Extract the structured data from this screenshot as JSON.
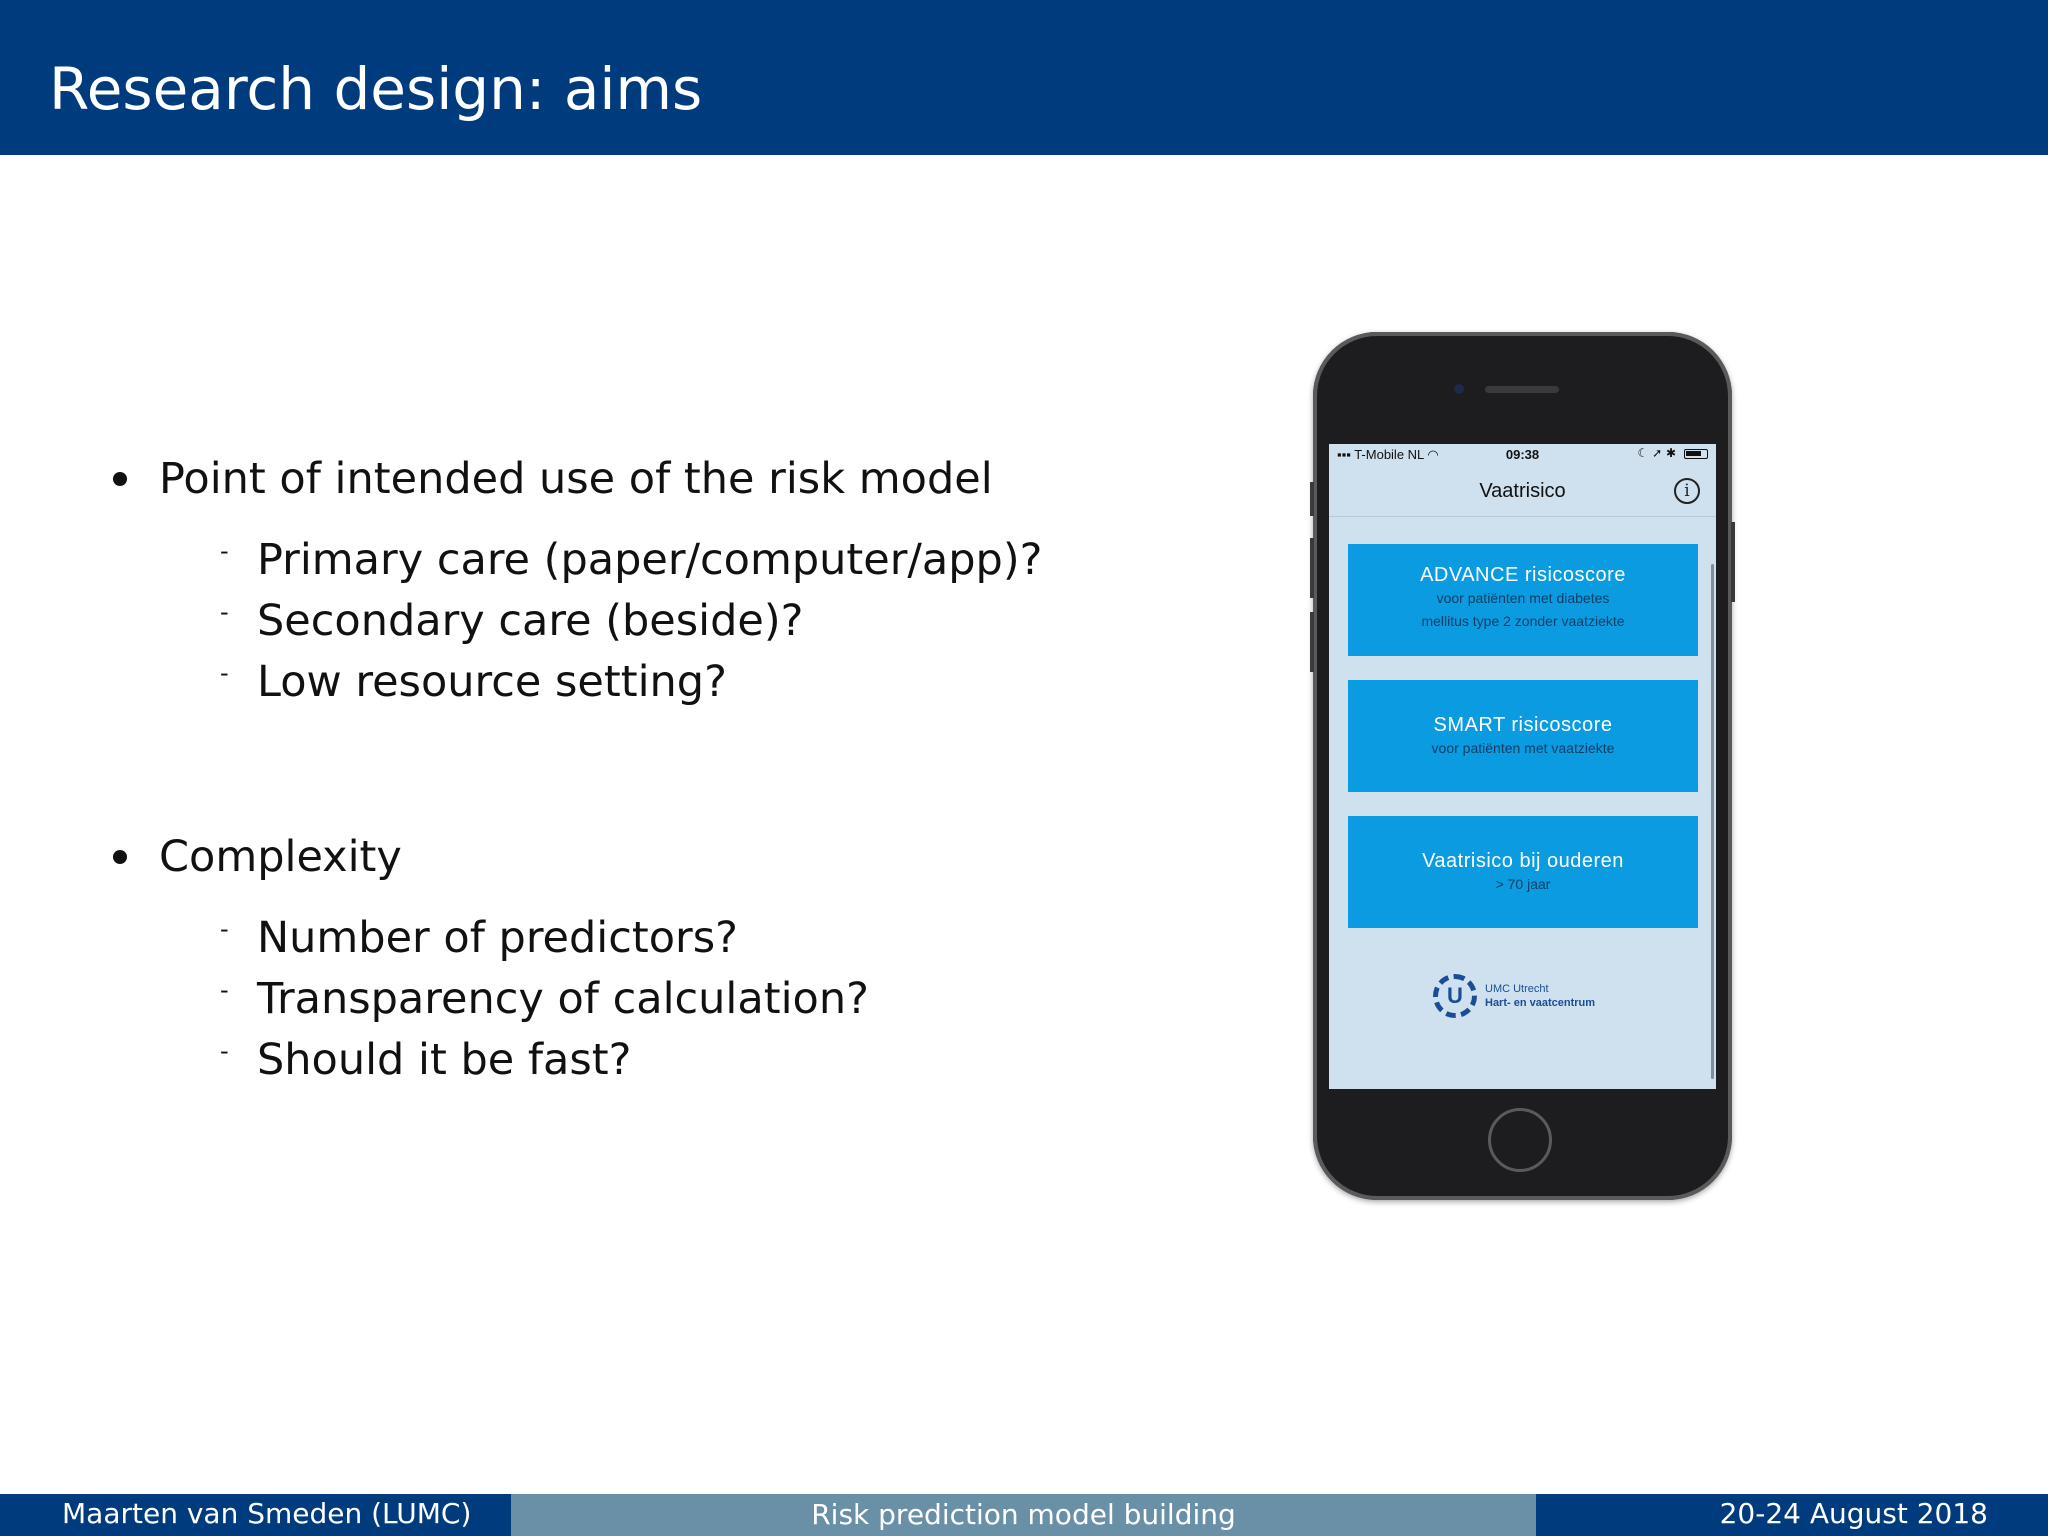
{
  "slide": {
    "title": "Research design: aims"
  },
  "bullets": [
    {
      "text": "Point of intended use of the risk model",
      "subitems": [
        "Primary care (paper/computer/app)?",
        "Secondary care (beside)?",
        "Low resource setting?"
      ]
    },
    {
      "text": "Complexity",
      "subitems": [
        "Number of predictors?",
        "Transparency of calculation?",
        "Should it be fast?"
      ]
    }
  ],
  "sub_marker": "-",
  "phone_app": {
    "status": {
      "carrier": "T-Mobile NL",
      "time": "09:38"
    },
    "nav_title": "Vaatrisico",
    "info_symbol": "i",
    "cards": [
      {
        "title": "ADVANCE risicoscore",
        "subtitle_lines": [
          "voor patiënten met diabetes",
          "mellitus type 2 zonder vaatziekte"
        ]
      },
      {
        "title": "SMART risicoscore",
        "subtitle_lines": [
          "voor patiënten met vaatziekte"
        ]
      },
      {
        "title": "Vaatrisico bij ouderen",
        "subtitle_lines": [
          "> 70 jaar"
        ]
      }
    ],
    "logo": {
      "letter": "U",
      "line1": "UMC Utrecht",
      "line2": "Hart- en vaatcentrum"
    },
    "colors": {
      "card": "#0a9be0",
      "screen": "#cfe0ee"
    }
  },
  "footer": {
    "author": "Maarten van Smeden  (LUMC)",
    "talk_title": "Risk prediction model building",
    "date": "20-24 August 2018"
  },
  "colors": {
    "header": "#003c7d",
    "footer_mid": "#6a90a8"
  }
}
